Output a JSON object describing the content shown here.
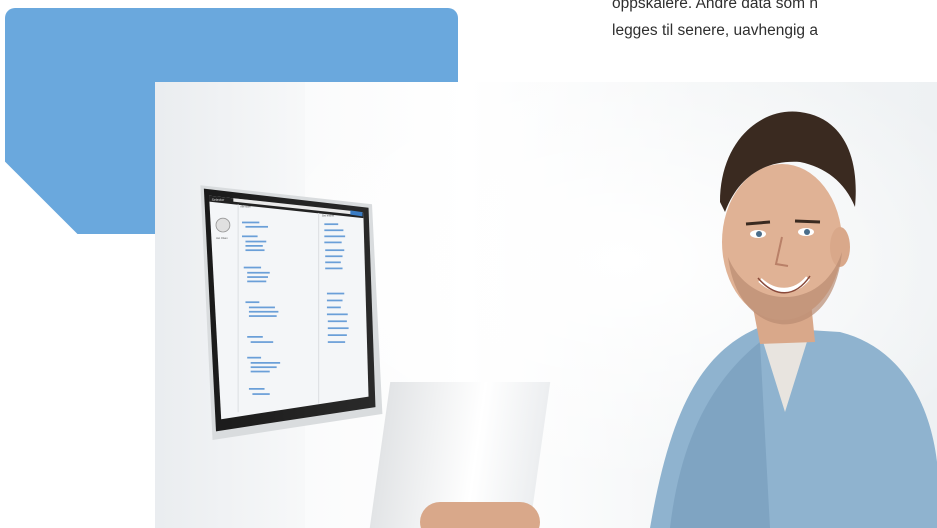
{
  "intro": {
    "line1": "oppskalere. Andre data som n",
    "line2": "legges til senere, uavhengig a"
  },
  "monitor_screen": {
    "app_name": "Selector",
    "search_placeholder": "Søk",
    "left_panel_title": "Jan Olsen",
    "main_header": "Alle sider",
    "right_header": "Sist endret"
  },
  "colors": {
    "accent_blue": "#6aa8dd",
    "screen_link": "#4a7fc0",
    "shirt_denim": "#8fb3cf"
  }
}
